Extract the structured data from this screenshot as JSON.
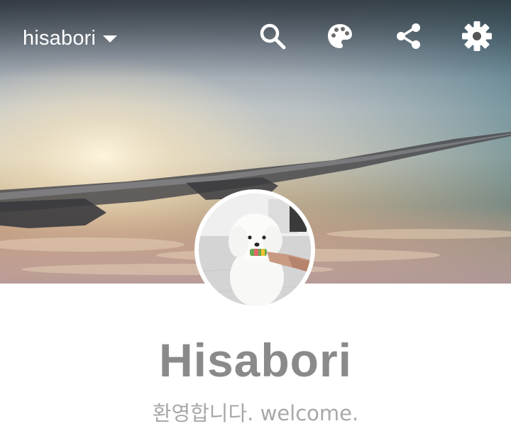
{
  "header": {
    "blog_name": "hisabori",
    "icons": {
      "search": "search-icon",
      "theme": "palette-icon",
      "share": "share-icon",
      "settings": "gear-icon"
    }
  },
  "profile": {
    "name": "Hisabori",
    "description": "환영합니다. welcome."
  },
  "colors": {
    "name_text": "#8a8a8a",
    "description_text": "#a8a8a8",
    "header_text": "#ffffff"
  }
}
